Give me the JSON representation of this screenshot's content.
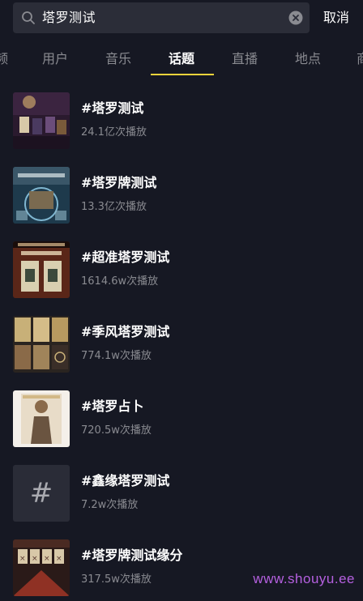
{
  "search": {
    "query": "塔罗测试",
    "cancel_label": "取消"
  },
  "tabs": [
    {
      "label": "频"
    },
    {
      "label": "用户"
    },
    {
      "label": "音乐"
    },
    {
      "label": "话题",
      "active": true
    },
    {
      "label": "直播"
    },
    {
      "label": "地点"
    },
    {
      "label": "商"
    }
  ],
  "results": [
    {
      "title": "#塔罗测试",
      "count": "24.1亿次播放"
    },
    {
      "title": "#塔罗牌测试",
      "count": "13.3亿次播放"
    },
    {
      "title": "#超准塔罗测试",
      "count": "1614.6w次播放"
    },
    {
      "title": "#季风塔罗测试",
      "count": "774.1w次播放"
    },
    {
      "title": "#塔罗占卜",
      "count": "720.5w次播放"
    },
    {
      "title": "#鑫缘塔罗测试",
      "count": "7.2w次播放"
    },
    {
      "title": "#塔罗牌测试缘分",
      "count": "317.5w次播放"
    }
  ],
  "hash_symbol": "#",
  "watermark": "www.shouyu.ee",
  "colors": {
    "background": "#161823",
    "search_box": "#2b2d38",
    "tab_indicator": "#f2d43b",
    "muted_text": "#8a8b91",
    "watermark": "#b560e0"
  }
}
